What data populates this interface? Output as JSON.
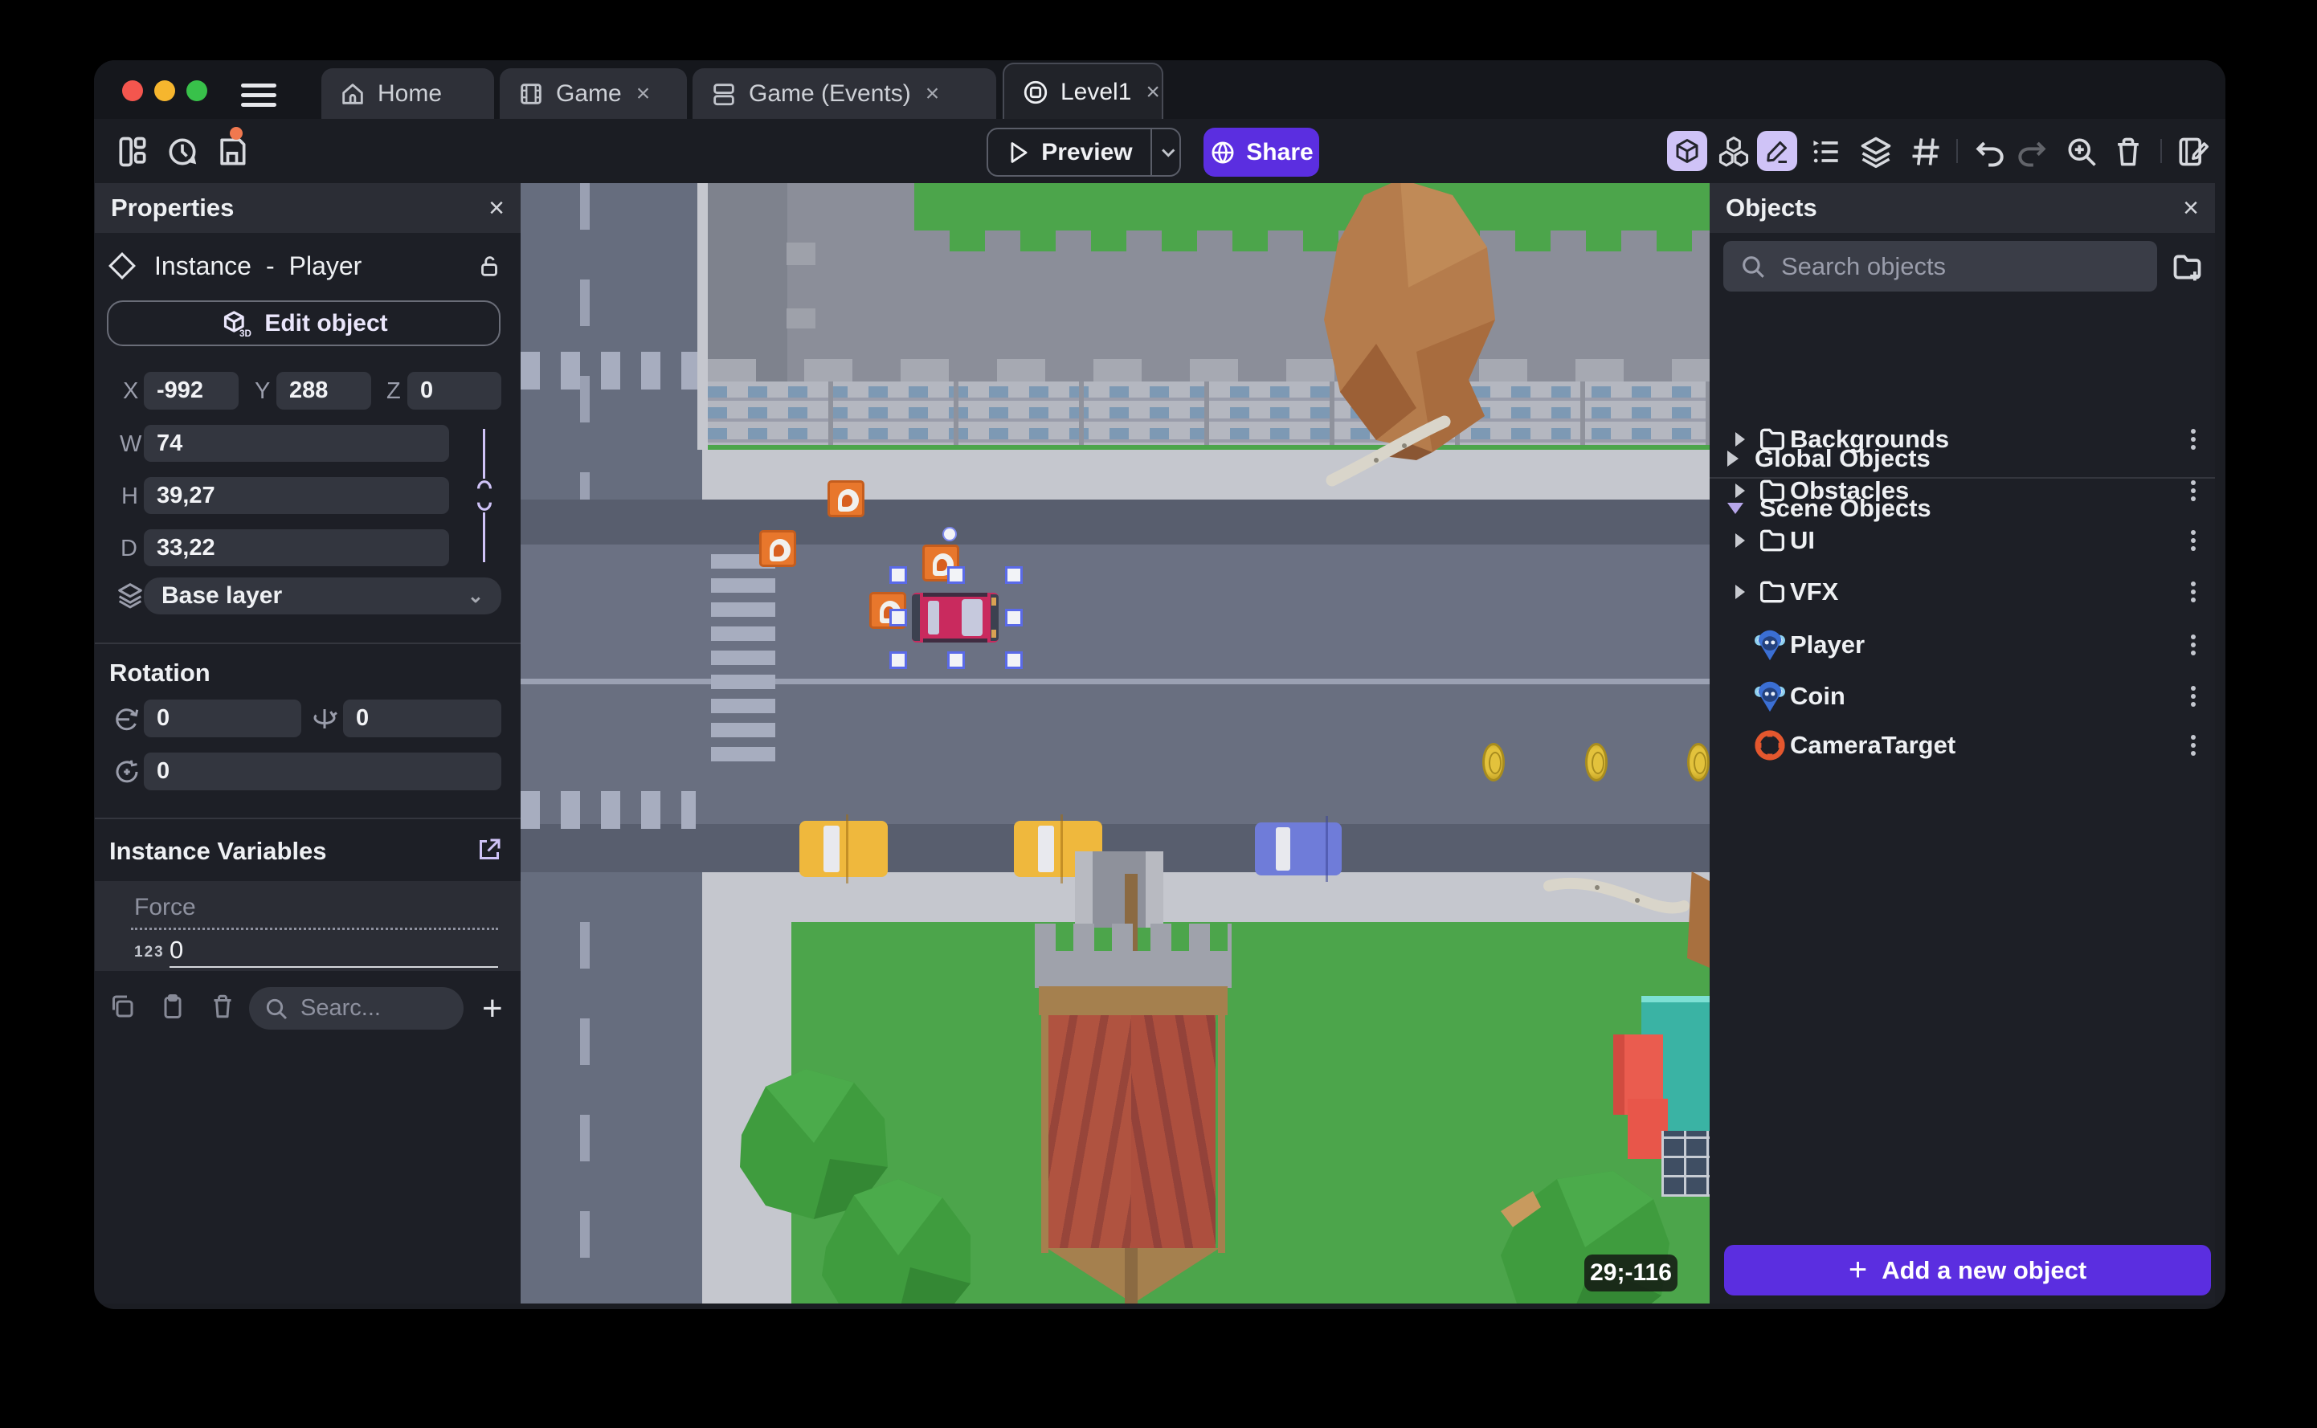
{
  "window": {
    "tabs": [
      {
        "label": "Home",
        "icon": "home-icon",
        "closable": false
      },
      {
        "label": "Game",
        "icon": "film-icon",
        "closable": true,
        "close_glyph": "×"
      },
      {
        "label": "Game (Events)",
        "icon": "events-icon",
        "closable": true,
        "close_glyph": "×"
      },
      {
        "label": "Level1",
        "icon": "scene-icon",
        "closable": true,
        "close_glyph": "×",
        "active": true
      }
    ]
  },
  "toolbar": {
    "preview_label": "Preview",
    "share_label": "Share"
  },
  "properties_panel": {
    "title": "Properties",
    "close_glyph": "×",
    "instance_label": "Instance",
    "separator": "-",
    "object_name": "Player",
    "edit_object_label": "Edit object",
    "position": {
      "x_label": "X",
      "x": "-992",
      "y_label": "Y",
      "y": "288",
      "z_label": "Z",
      "z": "0"
    },
    "size": {
      "w_label": "W",
      "w": "74",
      "h_label": "H",
      "h": "39,27",
      "d_label": "D",
      "d": "33,22"
    },
    "layer": "Base layer",
    "rotation_title": "Rotation",
    "rotation": {
      "x": "0",
      "y": "0",
      "z": "0"
    },
    "instance_variables_title": "Instance Variables",
    "variable_name": "Force",
    "variable_type_badge": "123",
    "variable_value": "0",
    "search_placeholder": "Searc...",
    "add_glyph": "+"
  },
  "objects_panel": {
    "title": "Objects",
    "close_glyph": "×",
    "search_placeholder": "Search objects",
    "global_group_label": "Global Objects",
    "scene_group_label": "Scene Objects",
    "items": [
      {
        "label": "Backgrounds",
        "type": "folder"
      },
      {
        "label": "Obstacles",
        "type": "folder"
      },
      {
        "label": "UI",
        "type": "folder"
      },
      {
        "label": "VFX",
        "type": "folder"
      },
      {
        "label": "Player",
        "type": "3d-object"
      },
      {
        "label": "Coin",
        "type": "3d-object"
      },
      {
        "label": "CameraTarget",
        "type": "camera-target"
      }
    ],
    "add_button_label": "Add a new object",
    "add_glyph": "+"
  },
  "canvas": {
    "cursor_coordinates": "29;-116",
    "selected_instance": "Player"
  },
  "colors": {
    "accent_purple": "#5b2ee0",
    "toolbar_toggle_active": "#cfc3f7",
    "unsaved_dot": "#f0784f",
    "traffic_red": "#f4564e",
    "traffic_yellow": "#f6b62e",
    "traffic_green": "#38c14a",
    "selection_handle_border": "#5a6ae8"
  }
}
